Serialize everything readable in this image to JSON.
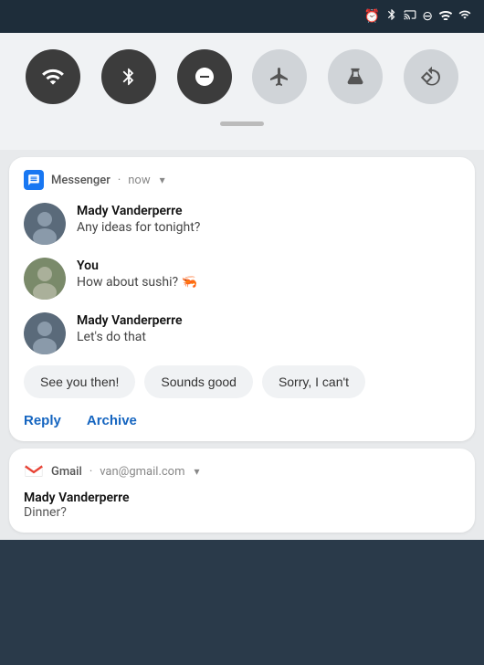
{
  "statusBar": {
    "icons": [
      "alarm",
      "bluetooth",
      "cast",
      "dnd",
      "wifi",
      "signal"
    ]
  },
  "quickSettings": {
    "buttons": [
      {
        "name": "wifi",
        "label": "WiFi",
        "active": true,
        "symbol": "▾"
      },
      {
        "name": "bluetooth",
        "label": "Bluetooth",
        "active": true,
        "symbol": "⦾"
      },
      {
        "name": "dnd",
        "label": "DND",
        "active": true,
        "symbol": "⊖"
      },
      {
        "name": "airplane",
        "label": "Airplane",
        "active": false,
        "symbol": "✈"
      },
      {
        "name": "flashlight",
        "label": "Flashlight",
        "active": false,
        "symbol": "🔦"
      },
      {
        "name": "rotate",
        "label": "Rotate",
        "active": false,
        "symbol": "⟳"
      }
    ]
  },
  "messengerNotif": {
    "appName": "Messenger",
    "time": "now",
    "messages": [
      {
        "sender": "Mady Vanderperre",
        "text": "Any ideas for tonight?",
        "avatarType": "mady"
      },
      {
        "sender": "You",
        "text": "How about sushi? 🦐",
        "avatarType": "you"
      },
      {
        "sender": "Mady Vanderperre",
        "text": "Let's do that",
        "avatarType": "mady"
      }
    ],
    "quickReplies": [
      "See you then!",
      "Sounds good",
      "Sorry, I can't"
    ],
    "actions": [
      "Reply",
      "Archive"
    ]
  },
  "gmailNotif": {
    "appName": "Gmail",
    "account": "van@gmail.com",
    "sender": "Mady Vanderperre",
    "subject": "Dinner?"
  }
}
